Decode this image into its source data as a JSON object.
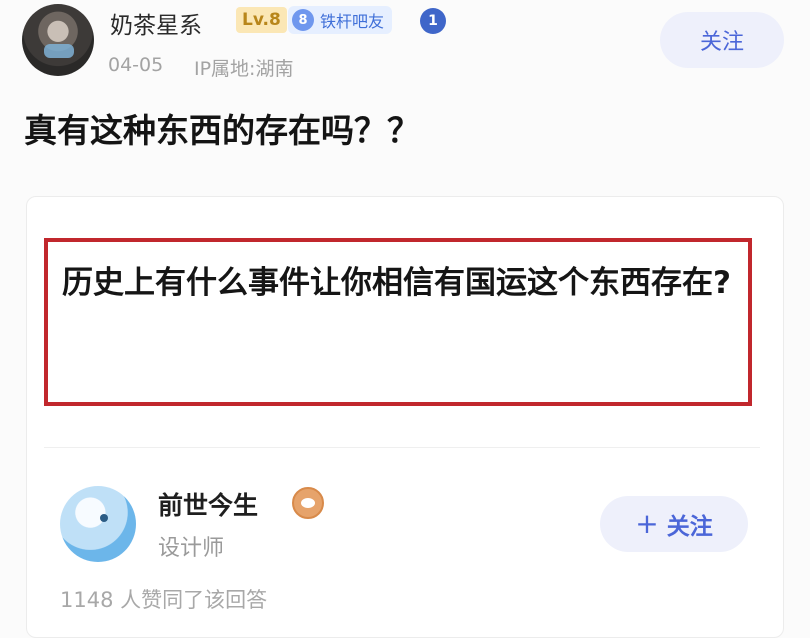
{
  "post": {
    "author": {
      "name": "奶茶星系",
      "level": "Lv.8",
      "fan_badge_num": "8",
      "fan_badge_label": "铁杆吧友",
      "rank_num": "1"
    },
    "date": "04-05",
    "ip_location": "IP属地:湖南",
    "follow_label": "关注",
    "title": "真有这种东西的存在吗？？"
  },
  "answer_card": {
    "question": "历史上有什么事件让你相信有国运这个东西存在?",
    "answerer": {
      "name": "前世今生",
      "role": "设计师"
    },
    "follow_plus": "+",
    "follow_label": "关注",
    "likes_text": "1148 人赞同了该回答"
  },
  "colors": {
    "accent": "#4b66d8",
    "highlight_border": "#c1272d",
    "level_badge": "#b8861a"
  }
}
